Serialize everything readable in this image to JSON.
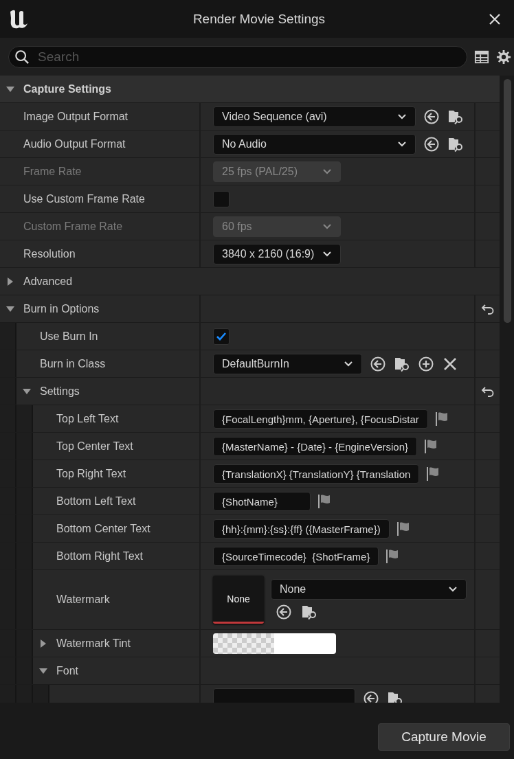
{
  "window": {
    "title": "Render Movie Settings"
  },
  "search": {
    "placeholder": "Search"
  },
  "properties": [
    {
      "kind": "category",
      "label": "Capture Settings",
      "expanded": true,
      "children": [
        {
          "kind": "asset-combo",
          "label": "Image Output Format",
          "value": "Video Sequence (avi)",
          "disabled": false
        },
        {
          "kind": "asset-combo",
          "label": "Audio Output Format",
          "value": "No Audio",
          "disabled": false
        },
        {
          "kind": "combo",
          "label": "Frame Rate",
          "value": "25 fps (PAL/25)",
          "disabled": true
        },
        {
          "kind": "checkbox",
          "label": "Use Custom Frame Rate",
          "checked": false,
          "disabled": false
        },
        {
          "kind": "combo",
          "label": "Custom Frame Rate",
          "value": "60 fps",
          "disabled": true
        },
        {
          "kind": "combo",
          "label": "Resolution",
          "value": "3840 x 2160 (16:9)",
          "disabled": false
        },
        {
          "kind": "subcategory",
          "label": "Advanced",
          "expanded": false
        },
        {
          "kind": "group",
          "label": "Burn in Options",
          "expanded": true,
          "reset": true,
          "children": [
            {
              "kind": "checkbox",
              "label": "Use Burn In",
              "checked": true,
              "disabled": false
            },
            {
              "kind": "class-combo",
              "label": "Burn in Class",
              "value": "DefaultBurnIn",
              "disabled": false
            },
            {
              "kind": "group",
              "label": "Settings",
              "expanded": true,
              "reset": true,
              "children": [
                {
                  "kind": "text",
                  "label": "Top Left Text",
                  "value": "{FocalLength}mm, {Aperture}, {FocusDistar",
                  "disabled": false
                },
                {
                  "kind": "text",
                  "label": "Top Center Text",
                  "value": "{MasterName} - {Date} - {EngineVersion}",
                  "disabled": false
                },
                {
                  "kind": "text",
                  "label": "Top Right Text",
                  "value": "{TranslationX} {TranslationY} {Translation",
                  "disabled": false
                },
                {
                  "kind": "text",
                  "label": "Bottom Left Text",
                  "value": "{ShotName}",
                  "disabled": false
                },
                {
                  "kind": "text",
                  "label": "Bottom Center Text",
                  "value": "{hh}:{mm}:{ss}:{ff} ({MasterFrame})",
                  "disabled": false
                },
                {
                  "kind": "text",
                  "label": "Bottom Right Text",
                  "value": "{SourceTimecode}  {ShotFrame}",
                  "disabled": false
                },
                {
                  "kind": "asset",
                  "label": "Watermark",
                  "thumbnail": "None",
                  "value": "None",
                  "disabled": false
                },
                {
                  "kind": "color",
                  "label": "Watermark Tint",
                  "expanded": false,
                  "color": "#ffffff"
                },
                {
                  "kind": "group",
                  "label": "Font",
                  "expanded": true,
                  "reset": false,
                  "children": [
                    {
                      "kind": "cut"
                    }
                  ]
                }
              ]
            }
          ]
        }
      ]
    }
  ],
  "footer": {
    "button": "Capture Movie"
  }
}
